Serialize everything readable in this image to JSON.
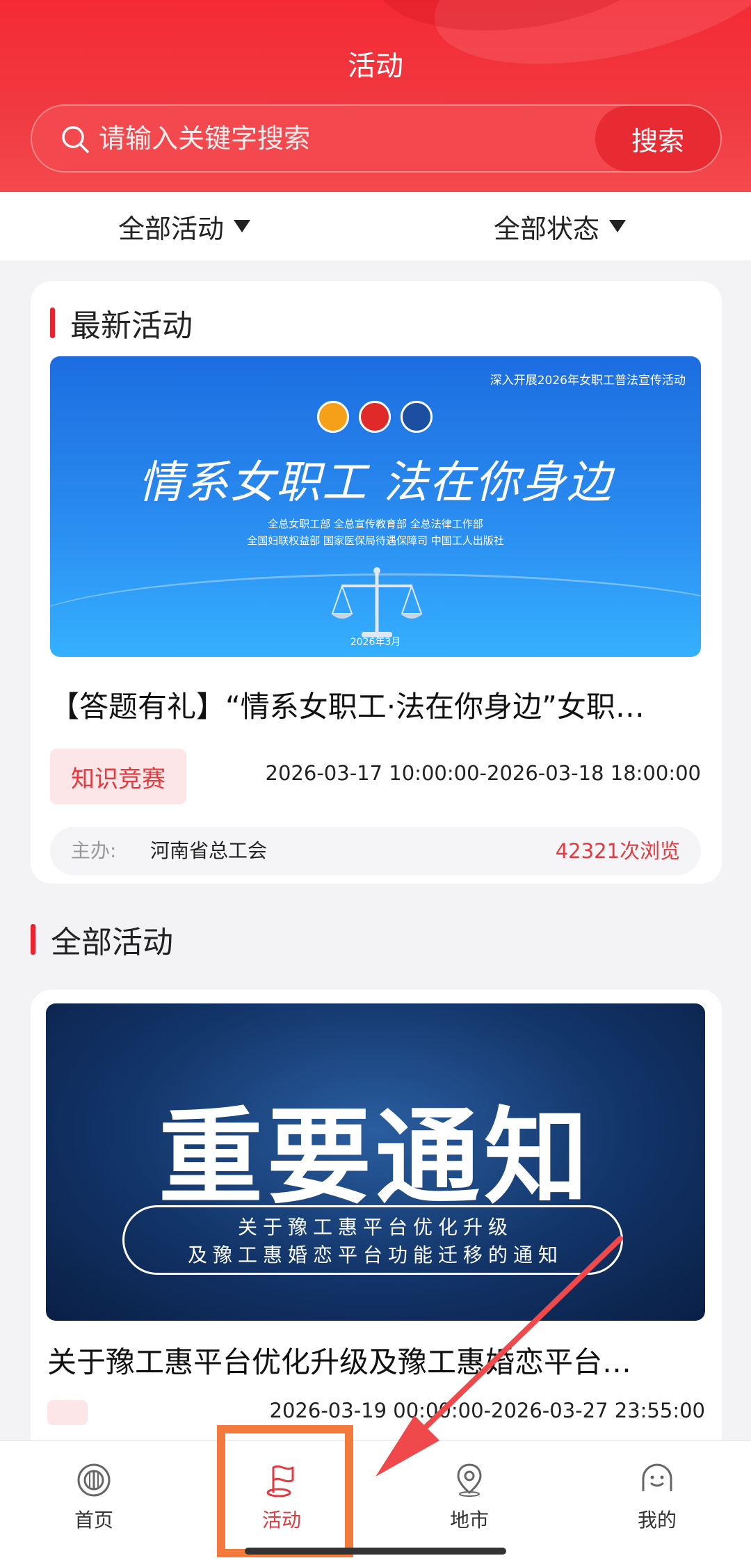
{
  "header": {
    "title": "活动",
    "search_placeholder": "请输入关键字搜索",
    "search_button": "搜索"
  },
  "filters": {
    "all_activities": "全部活动",
    "all_status": "全部状态"
  },
  "latest": {
    "section_title": "最新活动",
    "banner": {
      "top_text": "深入开展2026年女职工普法宣传活动",
      "slogan": "情系女职工 法在你身边",
      "org_line1": "全总女职工部 全总宣传教育部 全总法律工作部",
      "org_line2": "全国妇联权益部 国家医保局待遇保障司 中国工人出版社",
      "date": "2026年3月"
    },
    "title": "【答题有礼】“情系女职工·法在你身边”女职…",
    "tag": "知识竞赛",
    "time": "2026-03-17 10:00:00-2026-03-18 18:00:00",
    "host_label": "主办:",
    "host_name": "河南省总工会",
    "views": "42321次浏览"
  },
  "all": {
    "section_title": "全部活动",
    "banner": {
      "big_text": "重要通知",
      "line1": "关于豫工惠平台优化升级",
      "line2": "及豫工惠婚恋平台功能迁移的通知"
    },
    "title": "关于豫工惠平台优化升级及豫工惠婚恋平台…",
    "time": "2026-03-19 00:00:00-2026-03-27 23:55:00"
  },
  "tabbar": {
    "home": "首页",
    "activity": "活动",
    "city": "地市",
    "me": "我的"
  },
  "colors": {
    "brand_red": "#e8222e",
    "accent_orange": "#f37a3c",
    "arrow_red": "#f0494b"
  }
}
